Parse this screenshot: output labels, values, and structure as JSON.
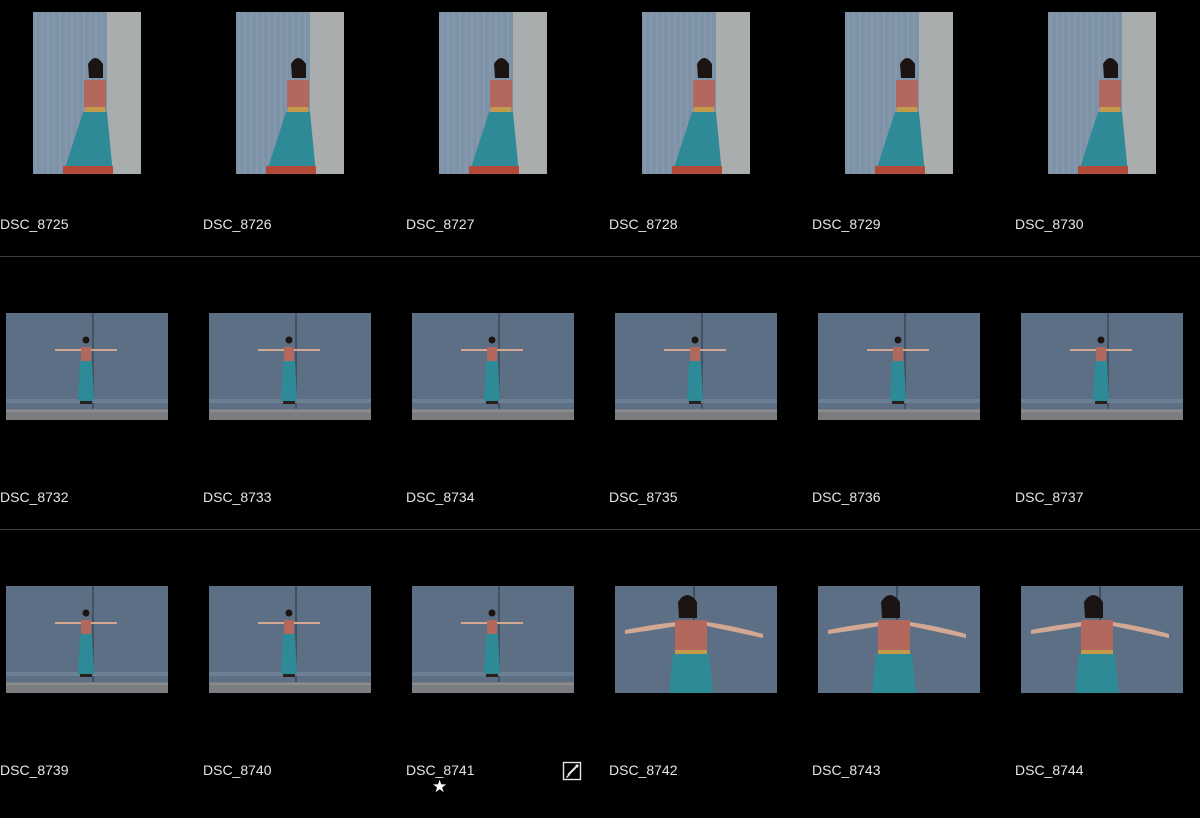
{
  "grid": {
    "rows": [
      {
        "items": [
          {
            "name": "DSC_8725",
            "orientation": "portrait",
            "pose": "lean"
          },
          {
            "name": "DSC_8726",
            "orientation": "portrait",
            "pose": "lean"
          },
          {
            "name": "DSC_8727",
            "orientation": "portrait",
            "pose": "lean"
          },
          {
            "name": "DSC_8728",
            "orientation": "portrait",
            "pose": "lean"
          },
          {
            "name": "DSC_8729",
            "orientation": "portrait",
            "pose": "lean"
          },
          {
            "name": "DSC_8730",
            "orientation": "portrait",
            "pose": "lean"
          }
        ]
      },
      {
        "items": [
          {
            "name": "DSC_8732",
            "orientation": "landscape",
            "pose": "arms-wide"
          },
          {
            "name": "DSC_8733",
            "orientation": "landscape",
            "pose": "arms-wide"
          },
          {
            "name": "DSC_8734",
            "orientation": "landscape",
            "pose": "arms-wide"
          },
          {
            "name": "DSC_8735",
            "orientation": "landscape",
            "pose": "arms-wide"
          },
          {
            "name": "DSC_8736",
            "orientation": "landscape",
            "pose": "arms-wide"
          },
          {
            "name": "DSC_8737",
            "orientation": "landscape",
            "pose": "arms-wide"
          }
        ]
      },
      {
        "items": [
          {
            "name": "DSC_8739",
            "orientation": "landscape",
            "pose": "arms-wide"
          },
          {
            "name": "DSC_8740",
            "orientation": "landscape",
            "pose": "arms-wide"
          },
          {
            "name": "DSC_8741",
            "orientation": "landscape",
            "pose": "arms-wide",
            "starred": true,
            "edited": true
          },
          {
            "name": "DSC_8742",
            "orientation": "landscape",
            "pose": "closeup"
          },
          {
            "name": "DSC_8743",
            "orientation": "landscape",
            "pose": "closeup"
          },
          {
            "name": "DSC_8744",
            "orientation": "landscape",
            "pose": "closeup"
          }
        ]
      }
    ]
  },
  "icons": {
    "rating": "star-icon",
    "edited": "edit-brush-icon"
  },
  "colors": {
    "background": "#000000",
    "separator": "#3e3e3e",
    "label_text": "#e6e6e6",
    "wall": "#5d6f84",
    "top": "#b2685c",
    "skirt": "#2e8a96"
  }
}
